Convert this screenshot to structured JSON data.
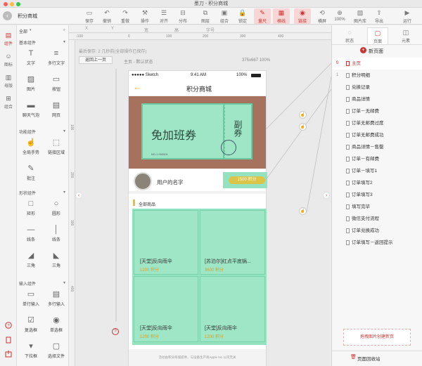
{
  "window_title": "墨刀 - 积分商城",
  "document_title": "积分商城",
  "toolbar": [
    {
      "label": "保存",
      "icon": "save-icon"
    },
    {
      "label": "撤销",
      "icon": "undo-icon"
    },
    {
      "label": "重做",
      "icon": "redo-icon"
    },
    {
      "label": "操作",
      "icon": "operate-icon"
    },
    {
      "label": "对齐",
      "icon": "align-icon"
    },
    {
      "label": "分布",
      "icon": "distribute-icon"
    },
    {
      "label": "图层",
      "icon": "layers-icon"
    },
    {
      "label": "组合",
      "icon": "group-icon"
    },
    {
      "label": "锁定",
      "icon": "lock-icon"
    },
    {
      "label": "量尺",
      "icon": "ruler-icon"
    },
    {
      "label": "格线",
      "icon": "grid-icon"
    },
    {
      "label": "链接",
      "icon": "link-icon"
    },
    {
      "label": "横屏",
      "icon": "rotate-icon"
    },
    {
      "label": "100%",
      "icon": "zoom-icon"
    },
    {
      "label": "图片库",
      "icon": "image-library-icon"
    },
    {
      "label": "导出",
      "icon": "export-icon"
    },
    {
      "label": "运行",
      "icon": "run-icon"
    }
  ],
  "left_rail": [
    {
      "label": "组件",
      "icon": "component-icon"
    },
    {
      "label": "图标",
      "icon": "icon-library-icon"
    },
    {
      "label": "母版",
      "icon": "master-icon"
    },
    {
      "label": "组合",
      "icon": "combination-icon"
    }
  ],
  "widget_filter": "全部",
  "widget_sections": [
    {
      "title": "基本组件",
      "items": [
        {
          "label": "文字",
          "icon": "text-icon"
        },
        {
          "label": "多行文字",
          "icon": "multiline-text-icon"
        },
        {
          "label": "图片",
          "icon": "picture-icon"
        },
        {
          "label": "按钮",
          "icon": "button-icon"
        },
        {
          "label": "聊天气泡",
          "icon": "chat-bubble-icon"
        },
        {
          "label": "网页",
          "icon": "webpage-icon"
        }
      ]
    },
    {
      "title": "功能组件",
      "items": [
        {
          "label": "全局手势",
          "icon": "gesture-icon"
        },
        {
          "label": "链接区域",
          "icon": "link-area-icon"
        },
        {
          "label": "批注",
          "icon": "annotation-icon"
        }
      ]
    },
    {
      "title": "形状组件",
      "items": [
        {
          "label": "矩形",
          "icon": "rectangle-icon"
        },
        {
          "label": "圆形",
          "icon": "circle-icon"
        },
        {
          "label": "线条",
          "icon": "line-icon"
        },
        {
          "label": "线条",
          "icon": "vertical-line-icon"
        },
        {
          "label": "三角",
          "icon": "triangle-icon"
        },
        {
          "label": "三角",
          "icon": "triangle-right-icon"
        }
      ]
    },
    {
      "title": "输入组件",
      "items": [
        {
          "label": "单行输入",
          "icon": "single-input-icon"
        },
        {
          "label": "多行输入",
          "icon": "multi-input-icon"
        },
        {
          "label": "复选框",
          "icon": "checkbox-icon"
        },
        {
          "label": "单选框",
          "icon": "radio-icon"
        },
        {
          "label": "下拉框",
          "icon": "dropdown-icon"
        },
        {
          "label": "选择文件",
          "icon": "file-icon"
        }
      ]
    }
  ],
  "props_bar": {
    "x": "X",
    "y": "Y",
    "w": "宽",
    "h": "高",
    "font_size": "字号"
  },
  "canvas": {
    "save_status": "最后保存: 2 几秒前(全部操作已保存)",
    "back_button": "返回上一页",
    "page_state": "主页 - 默认状态",
    "dimensions": "375x667 100%",
    "ruler_top": [
      "-100",
      "0",
      "100",
      "200",
      "300",
      "400"
    ],
    "ruler_left": [
      "100",
      "200",
      "300",
      "400"
    ]
  },
  "phone": {
    "carrier": "●●●●● Sketch",
    "time": "9:41 AM",
    "battery": "100%",
    "title": "积分商城",
    "coupon_text": "免加班券",
    "coupon_side": "副券",
    "coupon_serial": "NO.1 000001",
    "username": "用户的名字",
    "points_badge": "1500 积分",
    "section_title": "全部商品",
    "products": [
      {
        "name": "[天堂]反向雨伞",
        "points": "1200 积分"
      },
      {
        "name": "[苏泊尔]红点平底锅...",
        "points": "3600 积分"
      },
      {
        "name": "[天堂]反向雨伞",
        "points": "1200 积分"
      },
      {
        "name": "[天堂]反向雨伞",
        "points": "1200 积分"
      }
    ],
    "footer_note": "活动由积分商城提供，与设备生产商Apple Inc.公司无关"
  },
  "right_panel": {
    "tabs": [
      {
        "label": "状态",
        "icon": "status-icon"
      },
      {
        "label": "页面",
        "icon": "page-icon"
      },
      {
        "label": "元素",
        "icon": "element-icon"
      }
    ],
    "new_page": "新页面",
    "pages": [
      {
        "idx": "0",
        "name": "主页"
      },
      {
        "idx": "1",
        "name": "积分明细"
      },
      {
        "idx": "",
        "name": "兑换记录"
      },
      {
        "idx": "",
        "name": "商品详情"
      },
      {
        "idx": "",
        "name": "订单－无邮费"
      },
      {
        "idx": "",
        "name": "订单无邮费过度"
      },
      {
        "idx": "",
        "name": "订单无邮费成功"
      },
      {
        "idx": "",
        "name": "商品详情－售罄"
      },
      {
        "idx": "",
        "name": "订单－有邮费"
      },
      {
        "idx": "",
        "name": "订单－填写1"
      },
      {
        "idx": "",
        "name": "订单填写2"
      },
      {
        "idx": "",
        "name": "订单填写3"
      },
      {
        "idx": "",
        "name": "填写完毕"
      },
      {
        "idx": "",
        "name": "微信支付流程"
      },
      {
        "idx": "",
        "name": "订单兑换成功"
      },
      {
        "idx": "",
        "name": "订单填写－返回提示"
      }
    ],
    "drop_hint": "拖拽图片创建新页",
    "trash": "页面回收站"
  },
  "colors": {
    "accent": "#c3302a",
    "green": "#95e2c0",
    "coupon": "#9fe6c7",
    "banner_bg": "#a7725d",
    "badge": "#e8c034"
  }
}
